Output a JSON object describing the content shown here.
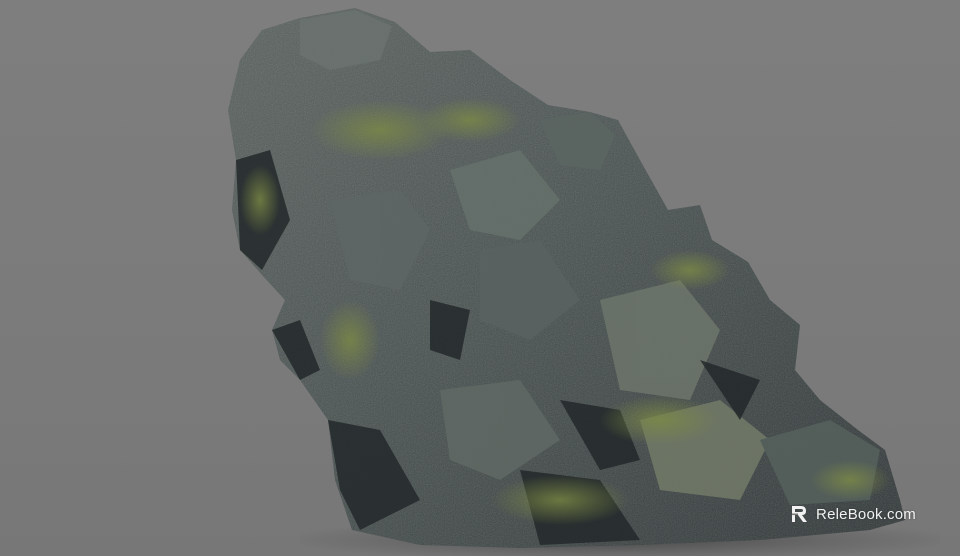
{
  "scene": {
    "subject": "",
    "background_color": "#7b7b7b",
    "rock_colors": {
      "dark": "#2c3233",
      "mid": "#4b5453",
      "light": "#6d7568",
      "moss": "#6c7a3e"
    }
  },
  "watermark": {
    "brand": "ReleBook",
    "suffix": ".com",
    "logo_icon": "relebook-logo-icon"
  }
}
